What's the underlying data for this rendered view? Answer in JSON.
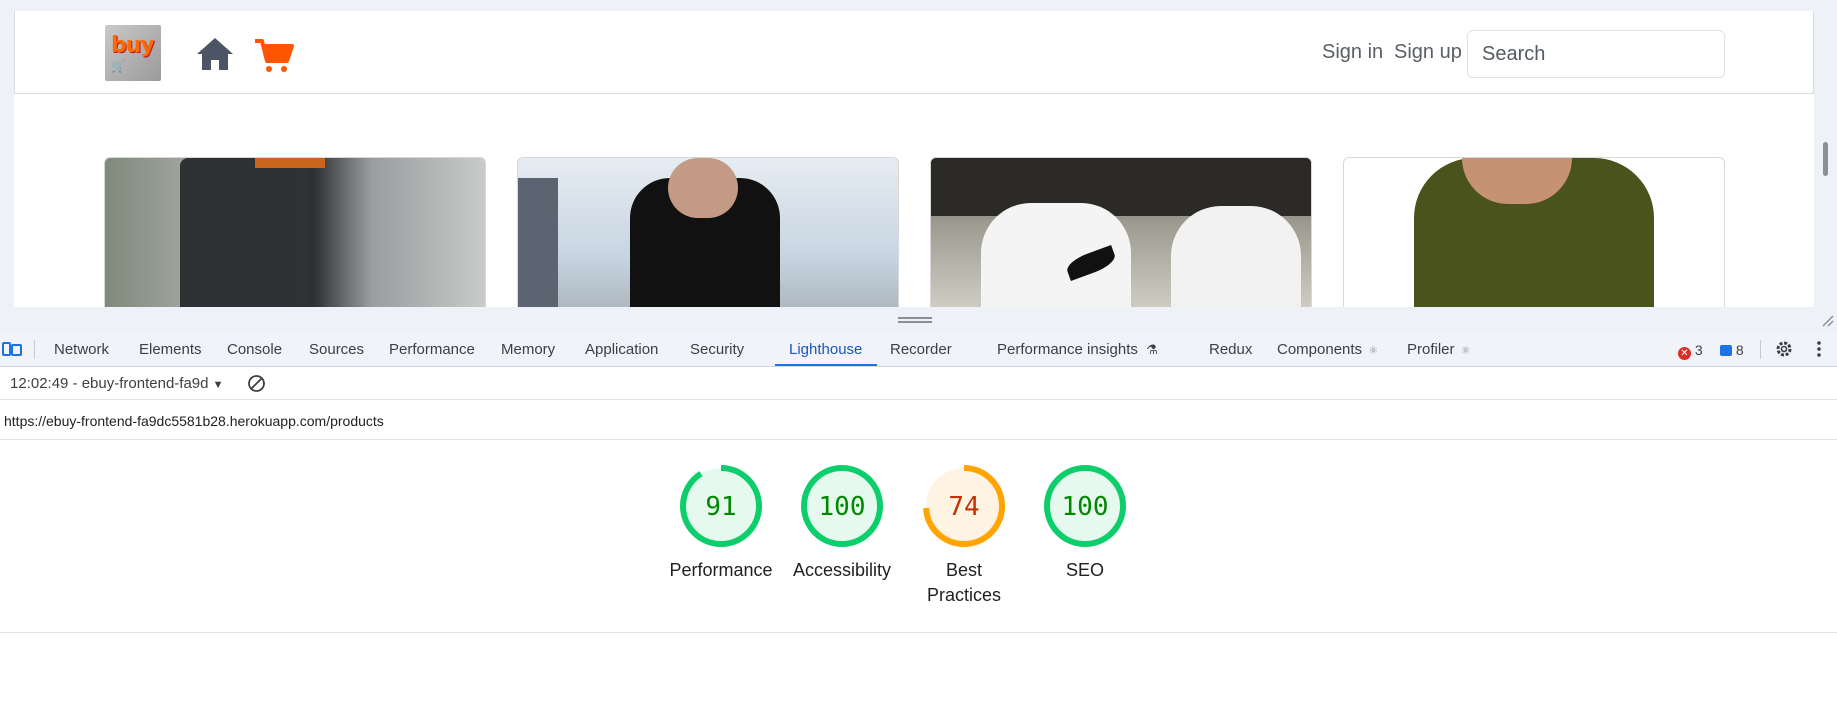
{
  "site": {
    "logo_text": "buy",
    "nav": {
      "sign_in": "Sign in",
      "sign_up": "Sign up"
    },
    "search": {
      "placeholder": "Search",
      "value": ""
    }
  },
  "devtools": {
    "tabs": [
      {
        "label": "Network"
      },
      {
        "label": "Elements"
      },
      {
        "label": "Console"
      },
      {
        "label": "Sources"
      },
      {
        "label": "Performance"
      },
      {
        "label": "Memory"
      },
      {
        "label": "Application"
      },
      {
        "label": "Security"
      },
      {
        "label": "Lighthouse",
        "active": true
      },
      {
        "label": "Recorder"
      },
      {
        "label": "Performance insights"
      },
      {
        "label": "Redux"
      },
      {
        "label": "Components"
      },
      {
        "label": "Profiler"
      }
    ],
    "error_count": "3",
    "message_count": "8",
    "report_select": "12:02:49 - ebuy-frontend-fa9d",
    "url": "https://ebuy-frontend-fa9dc5581b28.herokuapp.com/products",
    "colors": {
      "accent": "#1a73e8",
      "error": "#d93025",
      "message": "#1a73e8"
    }
  },
  "lighthouse": {
    "scores": [
      {
        "label": "Performance",
        "score": 91,
        "color": "#0cce6b",
        "bg": "#e6f9ee",
        "text_color": "#008800"
      },
      {
        "label": "Accessibility",
        "score": 100,
        "color": "#0cce6b",
        "bg": "#e6f9ee",
        "text_color": "#008800"
      },
      {
        "label": "Best Practices",
        "label_line1": "Best",
        "label_line2": "Practices",
        "score": 74,
        "color": "#ffa400",
        "bg": "#fff3e4",
        "text_color": "#c33300"
      },
      {
        "label": "SEO",
        "score": 100,
        "color": "#0cce6b",
        "bg": "#e6f9ee",
        "text_color": "#008800"
      }
    ]
  }
}
